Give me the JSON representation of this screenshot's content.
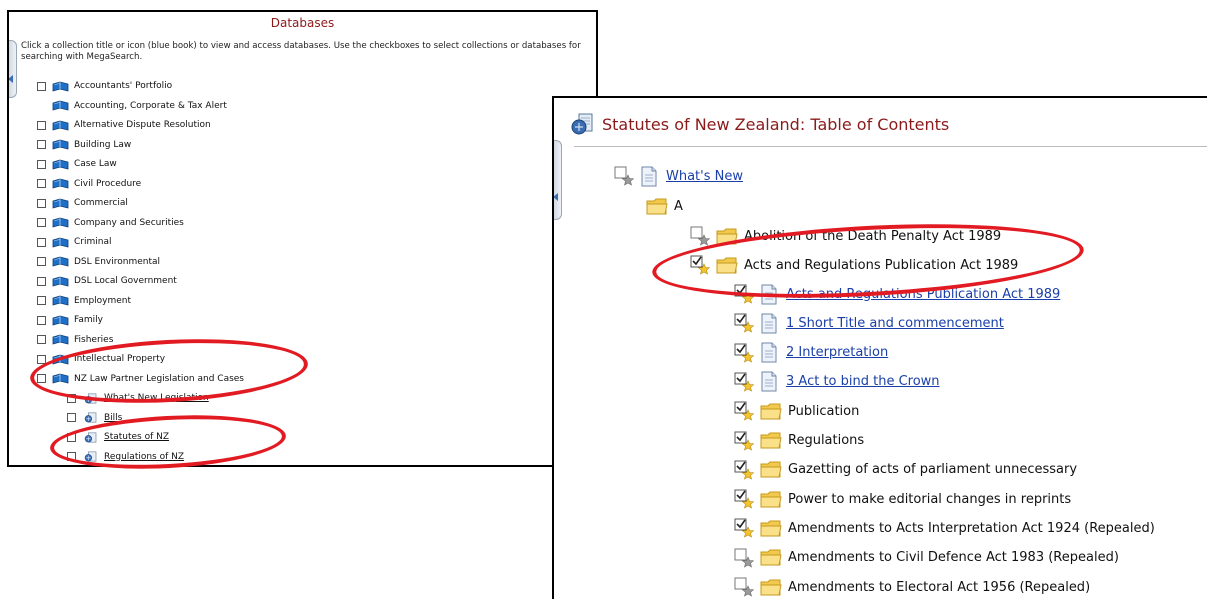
{
  "databases": {
    "title": "Databases",
    "intro": "Click a collection title or icon (blue book) to view and access databases. Use the checkboxes to select collections or databases for searching with MegaSearch.",
    "items": [
      {
        "label": "Accountants' Portfolio",
        "checkbox": true,
        "icon": "blue-book-icon"
      },
      {
        "label": "Accounting, Corporate & Tax Alert",
        "checkbox": false,
        "icon": "blue-book-icon"
      },
      {
        "label": "Alternative Dispute Resolution",
        "checkbox": true,
        "icon": "blue-book-icon"
      },
      {
        "label": "Building Law",
        "checkbox": true,
        "icon": "blue-book-icon"
      },
      {
        "label": "Case Law",
        "checkbox": true,
        "icon": "blue-book-icon"
      },
      {
        "label": "Civil Procedure",
        "checkbox": true,
        "icon": "blue-book-icon"
      },
      {
        "label": "Commercial",
        "checkbox": true,
        "icon": "blue-book-icon"
      },
      {
        "label": "Company and Securities",
        "checkbox": true,
        "icon": "blue-book-icon"
      },
      {
        "label": "Criminal",
        "checkbox": true,
        "icon": "blue-book-icon"
      },
      {
        "label": "DSL Environmental",
        "checkbox": true,
        "icon": "blue-book-icon"
      },
      {
        "label": "DSL Local Government",
        "checkbox": true,
        "icon": "blue-book-icon"
      },
      {
        "label": "Employment",
        "checkbox": true,
        "icon": "blue-book-icon"
      },
      {
        "label": "Family",
        "checkbox": true,
        "icon": "blue-book-icon"
      },
      {
        "label": "Fisheries",
        "checkbox": true,
        "icon": "blue-book-icon"
      },
      {
        "label": "Intellectual Property",
        "checkbox": true,
        "icon": "blue-book-icon"
      },
      {
        "label": "NZ Law Partner Legislation and Cases",
        "checkbox": true,
        "icon": "blue-book-icon"
      }
    ],
    "subitems": [
      {
        "label": "What's New Legislation",
        "icon": "database-icon"
      },
      {
        "label": "Bills",
        "icon": "database-icon"
      },
      {
        "label": "Statutes of NZ",
        "icon": "database-icon"
      },
      {
        "label": "Regulations of NZ",
        "icon": "database-icon"
      }
    ]
  },
  "toc": {
    "title": "Statutes of New Zealand: Table of Contents",
    "whats_new": "What's New",
    "letter": "A",
    "acts": [
      {
        "label": "Abolition of the Death Penalty Act 1989",
        "checked": false
      },
      {
        "label": "Acts and Regulations Publication Act 1989",
        "checked": true
      }
    ],
    "sections": [
      {
        "label": "Acts and Regulations Publication Act 1989",
        "type": "document",
        "link": true,
        "checked": true
      },
      {
        "label": "1 Short Title and commencement",
        "type": "document",
        "link": true,
        "checked": true
      },
      {
        "label": "2 Interpretation",
        "type": "document",
        "link": true,
        "checked": true
      },
      {
        "label": "3 Act to bind the Crown",
        "type": "document",
        "link": true,
        "checked": true
      },
      {
        "label": "Publication",
        "type": "folder",
        "link": false,
        "checked": true
      },
      {
        "label": "Regulations",
        "type": "folder",
        "link": false,
        "checked": true
      },
      {
        "label": "Gazetting of acts of parliament unnecessary",
        "type": "folder",
        "link": false,
        "checked": true
      },
      {
        "label": "Power to make editorial changes in reprints",
        "type": "folder",
        "link": false,
        "checked": true
      },
      {
        "label": "Amendments to Acts Interpretation Act 1924 (Repealed)",
        "type": "folder",
        "link": false,
        "checked": true
      },
      {
        "label": "Amendments to Civil Defence Act 1983 (Repealed)",
        "type": "folder",
        "link": false,
        "checked": false
      },
      {
        "label": "Amendments to Electoral Act 1956 (Repealed)",
        "type": "folder",
        "link": false,
        "checked": false
      }
    ]
  },
  "colors": {
    "title_red": "#8b1a1a",
    "link_blue": "#1a3fa8",
    "annotation_red": "#e21b23"
  }
}
